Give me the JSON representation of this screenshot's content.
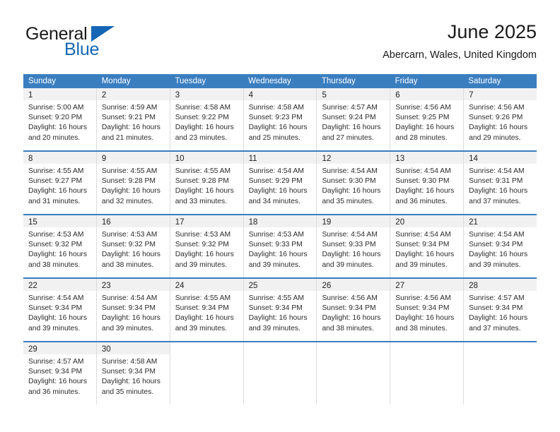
{
  "brand": {
    "name_top": "General",
    "name_bottom": "Blue",
    "accent_color": "#1566b4",
    "flag_icon": "triangle-flag-icon"
  },
  "header": {
    "title": "June 2025",
    "subtitle": "Abercarn, Wales, United Kingdom"
  },
  "calendar": {
    "header_bg": "#3a7ec0",
    "daynum_bg": "#f1f1f1",
    "weekday_headers": [
      "Sunday",
      "Monday",
      "Tuesday",
      "Wednesday",
      "Thursday",
      "Friday",
      "Saturday"
    ],
    "weeks": [
      [
        {
          "day": "1",
          "sunrise": "Sunrise: 5:00 AM",
          "sunset": "Sunset: 9:20 PM",
          "daylight1": "Daylight: 16 hours",
          "daylight2": "and 20 minutes."
        },
        {
          "day": "2",
          "sunrise": "Sunrise: 4:59 AM",
          "sunset": "Sunset: 9:21 PM",
          "daylight1": "Daylight: 16 hours",
          "daylight2": "and 21 minutes."
        },
        {
          "day": "3",
          "sunrise": "Sunrise: 4:58 AM",
          "sunset": "Sunset: 9:22 PM",
          "daylight1": "Daylight: 16 hours",
          "daylight2": "and 23 minutes."
        },
        {
          "day": "4",
          "sunrise": "Sunrise: 4:58 AM",
          "sunset": "Sunset: 9:23 PM",
          "daylight1": "Daylight: 16 hours",
          "daylight2": "and 25 minutes."
        },
        {
          "day": "5",
          "sunrise": "Sunrise: 4:57 AM",
          "sunset": "Sunset: 9:24 PM",
          "daylight1": "Daylight: 16 hours",
          "daylight2": "and 27 minutes."
        },
        {
          "day": "6",
          "sunrise": "Sunrise: 4:56 AM",
          "sunset": "Sunset: 9:25 PM",
          "daylight1": "Daylight: 16 hours",
          "daylight2": "and 28 minutes."
        },
        {
          "day": "7",
          "sunrise": "Sunrise: 4:56 AM",
          "sunset": "Sunset: 9:26 PM",
          "daylight1": "Daylight: 16 hours",
          "daylight2": "and 29 minutes."
        }
      ],
      [
        {
          "day": "8",
          "sunrise": "Sunrise: 4:55 AM",
          "sunset": "Sunset: 9:27 PM",
          "daylight1": "Daylight: 16 hours",
          "daylight2": "and 31 minutes."
        },
        {
          "day": "9",
          "sunrise": "Sunrise: 4:55 AM",
          "sunset": "Sunset: 9:28 PM",
          "daylight1": "Daylight: 16 hours",
          "daylight2": "and 32 minutes."
        },
        {
          "day": "10",
          "sunrise": "Sunrise: 4:55 AM",
          "sunset": "Sunset: 9:28 PM",
          "daylight1": "Daylight: 16 hours",
          "daylight2": "and 33 minutes."
        },
        {
          "day": "11",
          "sunrise": "Sunrise: 4:54 AM",
          "sunset": "Sunset: 9:29 PM",
          "daylight1": "Daylight: 16 hours",
          "daylight2": "and 34 minutes."
        },
        {
          "day": "12",
          "sunrise": "Sunrise: 4:54 AM",
          "sunset": "Sunset: 9:30 PM",
          "daylight1": "Daylight: 16 hours",
          "daylight2": "and 35 minutes."
        },
        {
          "day": "13",
          "sunrise": "Sunrise: 4:54 AM",
          "sunset": "Sunset: 9:30 PM",
          "daylight1": "Daylight: 16 hours",
          "daylight2": "and 36 minutes."
        },
        {
          "day": "14",
          "sunrise": "Sunrise: 4:54 AM",
          "sunset": "Sunset: 9:31 PM",
          "daylight1": "Daylight: 16 hours",
          "daylight2": "and 37 minutes."
        }
      ],
      [
        {
          "day": "15",
          "sunrise": "Sunrise: 4:53 AM",
          "sunset": "Sunset: 9:32 PM",
          "daylight1": "Daylight: 16 hours",
          "daylight2": "and 38 minutes."
        },
        {
          "day": "16",
          "sunrise": "Sunrise: 4:53 AM",
          "sunset": "Sunset: 9:32 PM",
          "daylight1": "Daylight: 16 hours",
          "daylight2": "and 38 minutes."
        },
        {
          "day": "17",
          "sunrise": "Sunrise: 4:53 AM",
          "sunset": "Sunset: 9:32 PM",
          "daylight1": "Daylight: 16 hours",
          "daylight2": "and 39 minutes."
        },
        {
          "day": "18",
          "sunrise": "Sunrise: 4:53 AM",
          "sunset": "Sunset: 9:33 PM",
          "daylight1": "Daylight: 16 hours",
          "daylight2": "and 39 minutes."
        },
        {
          "day": "19",
          "sunrise": "Sunrise: 4:54 AM",
          "sunset": "Sunset: 9:33 PM",
          "daylight1": "Daylight: 16 hours",
          "daylight2": "and 39 minutes."
        },
        {
          "day": "20",
          "sunrise": "Sunrise: 4:54 AM",
          "sunset": "Sunset: 9:34 PM",
          "daylight1": "Daylight: 16 hours",
          "daylight2": "and 39 minutes."
        },
        {
          "day": "21",
          "sunrise": "Sunrise: 4:54 AM",
          "sunset": "Sunset: 9:34 PM",
          "daylight1": "Daylight: 16 hours",
          "daylight2": "and 39 minutes."
        }
      ],
      [
        {
          "day": "22",
          "sunrise": "Sunrise: 4:54 AM",
          "sunset": "Sunset: 9:34 PM",
          "daylight1": "Daylight: 16 hours",
          "daylight2": "and 39 minutes."
        },
        {
          "day": "23",
          "sunrise": "Sunrise: 4:54 AM",
          "sunset": "Sunset: 9:34 PM",
          "daylight1": "Daylight: 16 hours",
          "daylight2": "and 39 minutes."
        },
        {
          "day": "24",
          "sunrise": "Sunrise: 4:55 AM",
          "sunset": "Sunset: 9:34 PM",
          "daylight1": "Daylight: 16 hours",
          "daylight2": "and 39 minutes."
        },
        {
          "day": "25",
          "sunrise": "Sunrise: 4:55 AM",
          "sunset": "Sunset: 9:34 PM",
          "daylight1": "Daylight: 16 hours",
          "daylight2": "and 39 minutes."
        },
        {
          "day": "26",
          "sunrise": "Sunrise: 4:56 AM",
          "sunset": "Sunset: 9:34 PM",
          "daylight1": "Daylight: 16 hours",
          "daylight2": "and 38 minutes."
        },
        {
          "day": "27",
          "sunrise": "Sunrise: 4:56 AM",
          "sunset": "Sunset: 9:34 PM",
          "daylight1": "Daylight: 16 hours",
          "daylight2": "and 38 minutes."
        },
        {
          "day": "28",
          "sunrise": "Sunrise: 4:57 AM",
          "sunset": "Sunset: 9:34 PM",
          "daylight1": "Daylight: 16 hours",
          "daylight2": "and 37 minutes."
        }
      ],
      [
        {
          "day": "29",
          "sunrise": "Sunrise: 4:57 AM",
          "sunset": "Sunset: 9:34 PM",
          "daylight1": "Daylight: 16 hours",
          "daylight2": "and 36 minutes."
        },
        {
          "day": "30",
          "sunrise": "Sunrise: 4:58 AM",
          "sunset": "Sunset: 9:34 PM",
          "daylight1": "Daylight: 16 hours",
          "daylight2": "and 35 minutes."
        },
        {
          "day": "",
          "sunrise": "",
          "sunset": "",
          "daylight1": "",
          "daylight2": ""
        },
        {
          "day": "",
          "sunrise": "",
          "sunset": "",
          "daylight1": "",
          "daylight2": ""
        },
        {
          "day": "",
          "sunrise": "",
          "sunset": "",
          "daylight1": "",
          "daylight2": ""
        },
        {
          "day": "",
          "sunrise": "",
          "sunset": "",
          "daylight1": "",
          "daylight2": ""
        },
        {
          "day": "",
          "sunrise": "",
          "sunset": "",
          "daylight1": "",
          "daylight2": ""
        }
      ]
    ]
  }
}
